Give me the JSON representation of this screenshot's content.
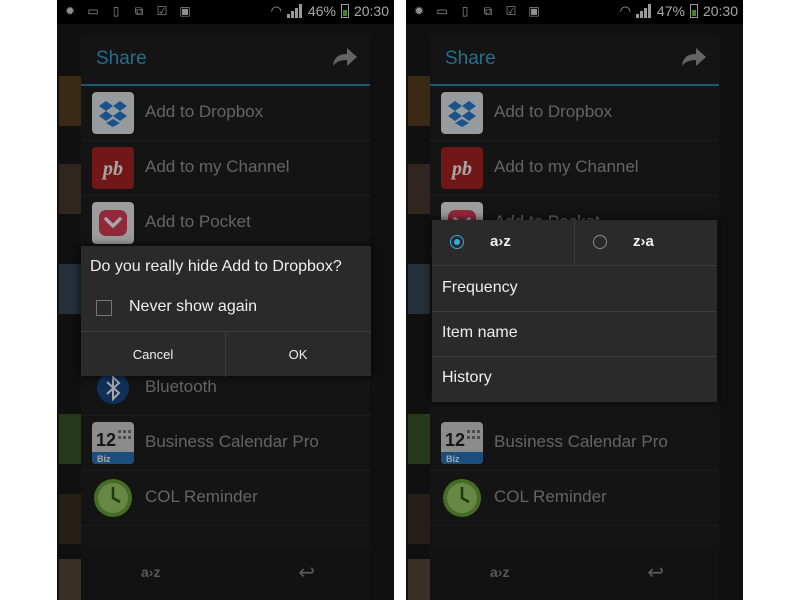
{
  "screens": [
    {
      "status": {
        "battery": "46%",
        "time": "20:30"
      },
      "share": {
        "title": "Share",
        "items": [
          {
            "label": "Add to Dropbox",
            "icon": "dropbox-icon"
          },
          {
            "label": "Add to my Channel",
            "icon": "pb-channel-icon"
          },
          {
            "label": "Add to Pocket",
            "icon": "pocket-icon"
          },
          {
            "label": "",
            "icon": "blank"
          },
          {
            "label": "Bluetooth",
            "icon": "bluetooth-icon"
          },
          {
            "label": "Business Calendar Pro",
            "icon": "calendar-icon"
          },
          {
            "label": "COL Reminder",
            "icon": "clock-icon"
          }
        ],
        "footer": {
          "sort_label": "a›z"
        }
      },
      "confirm": {
        "question": "Do you really hide Add to Dropbox?",
        "checkbox_label": "Never show again",
        "cancel_label": "Cancel",
        "ok_label": "OK"
      }
    },
    {
      "status": {
        "battery": "47%",
        "time": "20:30"
      },
      "share": {
        "title": "Share",
        "items": [
          {
            "label": "Add to Dropbox",
            "icon": "dropbox-icon"
          },
          {
            "label": "Add to my Channel",
            "icon": "pb-channel-icon"
          },
          {
            "label": "Add to Pocket",
            "icon": "pocket-icon"
          },
          {
            "label": "",
            "icon": "blank"
          },
          {
            "label": "",
            "icon": "blank"
          },
          {
            "label": "Business Calendar Pro",
            "icon": "calendar-icon"
          },
          {
            "label": "COL Reminder",
            "icon": "clock-icon"
          }
        ],
        "footer": {
          "sort_label": "a›z"
        }
      },
      "sort_popup": {
        "tabs": [
          {
            "label": "a›z",
            "selected": true
          },
          {
            "label": "z›a",
            "selected": false
          }
        ],
        "options": [
          "Frequency",
          "Item name",
          "History"
        ]
      }
    }
  ],
  "colors": {
    "accent": "#3aa8d8",
    "dialog_bg": "#2a2a2a",
    "share_bg": "#202020"
  }
}
